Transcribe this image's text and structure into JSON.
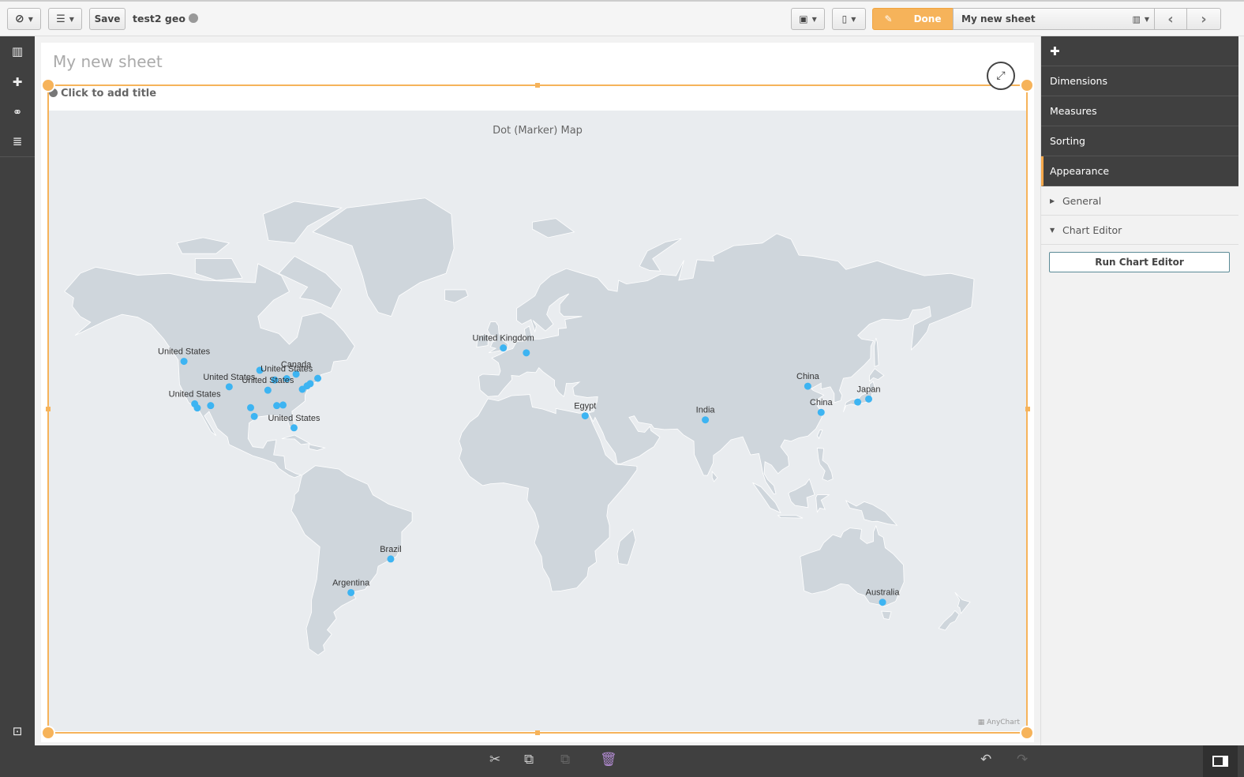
{
  "toolbar": {
    "save_label": "Save",
    "app_name": "test2 geo",
    "done_label": "Done",
    "sheet_name": "My new sheet"
  },
  "sheet": {
    "title": "My new sheet",
    "chart_title_placeholder": "Click to add title"
  },
  "panel": {
    "items": [
      {
        "label": "Dimensions"
      },
      {
        "label": "Measures"
      },
      {
        "label": "Sorting"
      },
      {
        "label": "Appearance",
        "active": true
      }
    ],
    "sections": [
      {
        "label": "General",
        "expanded": false
      },
      {
        "label": "Chart Editor",
        "expanded": true
      }
    ],
    "run_button": "Run Chart Editor"
  },
  "colors": {
    "accent": "#f6a84a",
    "marker": "#3db4f2",
    "land": "#cfd6dc",
    "background": "#e9ecef",
    "panel": "#404040"
  },
  "chart_data": {
    "type": "scatter",
    "subtype": "marker-map",
    "title": "Dot (Marker) Map",
    "credits": "AnyChart",
    "points": [
      {
        "label": "United States",
        "lon": -122.3,
        "lat": 47.6
      },
      {
        "label": "",
        "lon": -93.3,
        "lat": 44.9
      },
      {
        "label": "United States",
        "lon": -105.0,
        "lat": 39.7
      },
      {
        "label": "Canada",
        "lon": -79.4,
        "lat": 43.7
      },
      {
        "label": "United States",
        "lon": -83.0,
        "lat": 42.3
      },
      {
        "label": "",
        "lon": -87.6,
        "lat": 41.9
      },
      {
        "label": "",
        "lon": -71.1,
        "lat": 42.4
      },
      {
        "label": "",
        "lon": -74.0,
        "lat": 40.7
      },
      {
        "label": "",
        "lon": -75.2,
        "lat": 40.0
      },
      {
        "label": "",
        "lon": -77.0,
        "lat": 38.9
      },
      {
        "label": "United States",
        "lon": -118.2,
        "lat": 34.1
      },
      {
        "label": "",
        "lon": -117.2,
        "lat": 32.7
      },
      {
        "label": "",
        "lon": -112.1,
        "lat": 33.5
      },
      {
        "label": "United States",
        "lon": -90.2,
        "lat": 38.6
      },
      {
        "label": "",
        "lon": -96.8,
        "lat": 32.8
      },
      {
        "label": "",
        "lon": -86.8,
        "lat": 33.5
      },
      {
        "label": "",
        "lon": -84.4,
        "lat": 33.7
      },
      {
        "label": "",
        "lon": -95.4,
        "lat": 29.8
      },
      {
        "label": "United States",
        "lon": -80.2,
        "lat": 25.8
      },
      {
        "label": "United Kingdom",
        "lon": -0.1,
        "lat": 51.5
      },
      {
        "label": "",
        "lon": 8.7,
        "lat": 50.1
      },
      {
        "label": "Egypt",
        "lon": 31.2,
        "lat": 30.0
      },
      {
        "label": "India",
        "lon": 77.2,
        "lat": 28.6
      },
      {
        "label": "China",
        "lon": 116.4,
        "lat": 39.9
      },
      {
        "label": "China",
        "lon": 121.5,
        "lat": 31.2
      },
      {
        "label": "Japan",
        "lon": 139.7,
        "lat": 35.7
      },
      {
        "label": "",
        "lon": 135.5,
        "lat": 34.7
      },
      {
        "label": "Brazil",
        "lon": -43.2,
        "lat": -22.9
      },
      {
        "label": "Argentina",
        "lon": -58.4,
        "lat": -34.6
      },
      {
        "label": "Australia",
        "lon": 145.0,
        "lat": -37.8
      }
    ]
  }
}
